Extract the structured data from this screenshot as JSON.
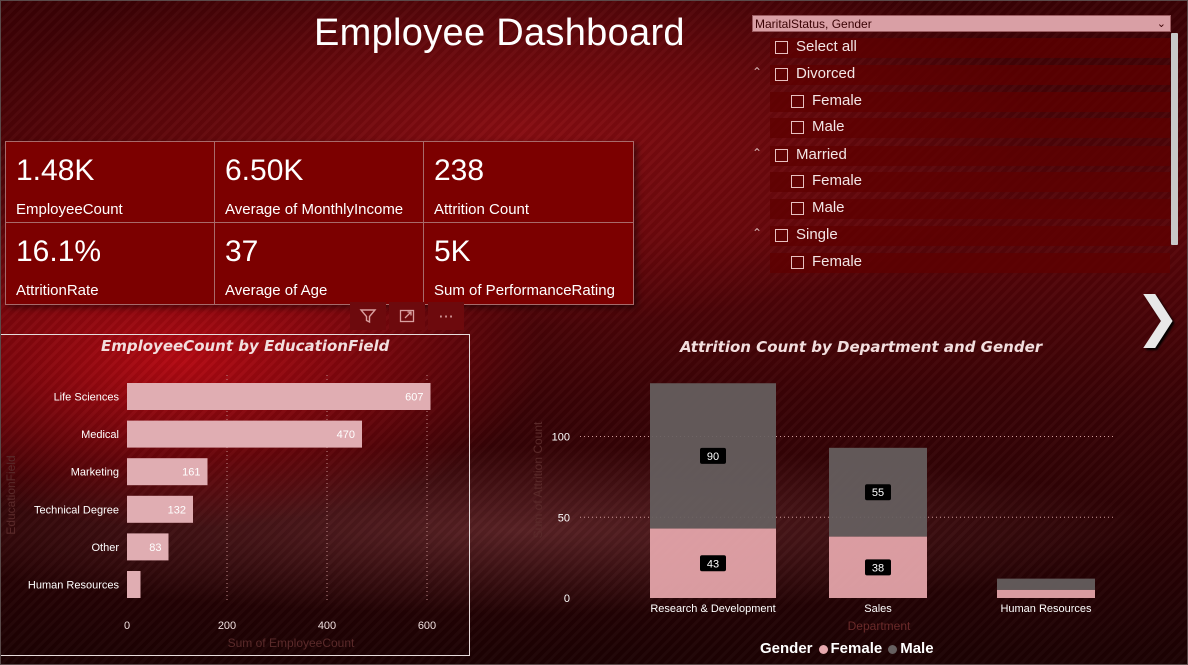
{
  "title": "Employee Dashboard",
  "kpis": [
    {
      "value": "1.48K",
      "label": "EmployeeCount"
    },
    {
      "value": "6.50K",
      "label": "Average of MonthlyIncome"
    },
    {
      "value": "238",
      "label": "Attrition Count"
    },
    {
      "value": "16.1%",
      "label": "AttritionRate"
    },
    {
      "value": "37",
      "label": "Average of Age"
    },
    {
      "value": "5K",
      "label": "Sum of PerformanceRating"
    }
  ],
  "visual_header": {
    "icons": [
      "filter-icon",
      "focus-mode-icon",
      "more-options-icon"
    ],
    "more_label": "···"
  },
  "slicer": {
    "header": "MaritalStatus, Gender",
    "items": [
      {
        "label": "Select all"
      },
      {
        "label": "Divorced",
        "expanded": true
      },
      {
        "label": "Female"
      },
      {
        "label": "Male"
      },
      {
        "label": "Married",
        "expanded": true
      },
      {
        "label": "Female"
      },
      {
        "label": "Male"
      },
      {
        "label": "Single",
        "expanded": true
      },
      {
        "label": "Female"
      }
    ]
  },
  "colors": {
    "bar": "#e0adb2",
    "female": "#e8a8ae",
    "male": "#666060",
    "kpi_bg": "#7c0000"
  },
  "chart_data": [
    {
      "type": "bar",
      "orientation": "horizontal",
      "title": "EmployeeCount by EducationField",
      "xlabel": "Sum of EmployeeCount",
      "ylabel": "EducationField",
      "categories": [
        "Life Sciences",
        "Medical",
        "Marketing",
        "Technical Degree",
        "Other",
        "Human Resources"
      ],
      "values": [
        607,
        470,
        161,
        132,
        83,
        27
      ],
      "data_labels": [
        "607",
        "470",
        "161",
        "132",
        "83",
        ""
      ],
      "xticks": [
        "0",
        "200",
        "400",
        "600"
      ],
      "xlim": [
        0,
        620
      ],
      "grid": true
    },
    {
      "type": "bar",
      "stacked": true,
      "title": "Attrition Count by Department and Gender",
      "xlabel": "Department",
      "ylabel": "Sum of Attrition Count",
      "categories": [
        "Research & Development",
        "Sales",
        "Human Resources"
      ],
      "series": [
        {
          "name": "Female",
          "values": [
            43,
            38,
            5
          ],
          "data_labels": [
            "43",
            "38",
            ""
          ]
        },
        {
          "name": "Male",
          "values": [
            90,
            55,
            7
          ],
          "data_labels": [
            "90",
            "55",
            ""
          ]
        }
      ],
      "yticks": [
        "0",
        "50",
        "100"
      ],
      "ylim": [
        0,
        135
      ],
      "legend": {
        "title": "Gender",
        "position": "bottom"
      },
      "grid": true
    }
  ]
}
